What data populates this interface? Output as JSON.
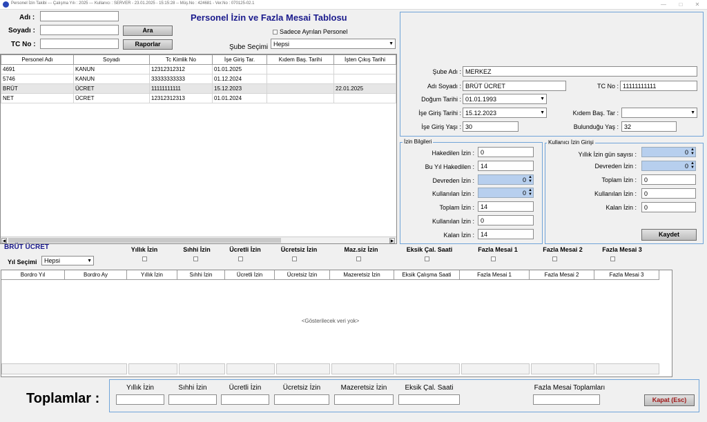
{
  "window": {
    "title": "Personel İzin Takibi  ---  Çalışma Yılı : 2025  ---  Kullanıcı : SERVER - 23.01.2025 - 15:15:28 -- Müş.No : 424681 - Ver.No : 070125-02.1"
  },
  "page_title": "Personel İzin ve Fazla Mesai Tablosu",
  "search": {
    "adi_label": "Adı :",
    "soyadi_label": "Soyadı :",
    "tcno_label": "TC No :",
    "ara_button": "Ara",
    "raporlar_button": "Raporlar",
    "sadece_ayrilan": "Sadece Ayrılan Personel",
    "sube_label": "Şube Seçimi",
    "sube_value": "Hepsi"
  },
  "personel_table": {
    "columns": [
      "Personel Adı",
      "Soyadı",
      "Tc Kimlik No",
      "İşe Giriş Tar.",
      "Kıdem Baş. Tarihi",
      "İşten Çıkış Tarihi"
    ],
    "rows": [
      [
        "4691",
        "KANUN",
        "12312312312",
        "01.01.2025",
        "",
        ""
      ],
      [
        "5746",
        "KANUN",
        "33333333333",
        "01.12.2024",
        "",
        ""
      ],
      [
        "BRÜT",
        "ÜCRET",
        "11111111111",
        "15.12.2023",
        "",
        "22.01.2025"
      ],
      [
        "NET",
        "ÜCRET",
        "12312312313",
        "01.01.2024",
        "",
        ""
      ]
    ]
  },
  "detail": {
    "sube_label": "Şube Adı :",
    "sube_value": "MERKEZ",
    "adsoyad_label": "Adı Soyadı :",
    "adsoyad_value": "BRÜT ÜCRET",
    "tcno_label": "TC No :",
    "tcno_value": "11111111111",
    "dogum_label": "Doğum Tarihi :",
    "dogum_value": "01.01.1993",
    "isegiris_label": "İşe Giriş Tarihi :",
    "isegiris_value": "15.12.2023",
    "kidem_label": "Kıdem Baş. Tar :",
    "kidem_value": "",
    "isegiris_yas_label": "İşe Giriş Yaşı :",
    "isegiris_yas_value": "30",
    "bulundugu_yas_label": "Bulunduğu Yaş :",
    "bulundugu_yas_value": "32"
  },
  "izin_bilgileri": {
    "title": "İzin Bilgileri",
    "fields": [
      {
        "label": "Hakedilen İzin :",
        "value": "0"
      },
      {
        "label": "Bu Yıl Hakedilen :",
        "value": "14"
      },
      {
        "label": "Devreden İzin :",
        "value": "0"
      },
      {
        "label": "Kullanılan İzin :",
        "value": "0"
      },
      {
        "label": "Toplam İzin :",
        "value": "14"
      },
      {
        "label": "Kullanılan İzin :",
        "value": "0"
      },
      {
        "label": "Kalan İzin :",
        "value": "14"
      }
    ]
  },
  "kullanici_izin": {
    "title": "Kullanıcı İzin Girişi",
    "fields": [
      {
        "label": "Yıllık İzin gün sayısı :",
        "value": "0"
      },
      {
        "label": "Devreden İzin :",
        "value": "0"
      },
      {
        "label": "Toplam İzin :",
        "value": "0"
      },
      {
        "label": "Kullanılan İzin :",
        "value": "0"
      },
      {
        "label": "Kalan İzin :",
        "value": "0"
      }
    ],
    "kaydet_button": "Kaydet"
  },
  "section": {
    "person_name": "BRÜT ÜCRET",
    "yil_label": "Yıl Seçimi",
    "yil_value": "Hepsi",
    "filter_labels": [
      "Yıllık İzin",
      "Sıhhi İzin",
      "Ücretli İzin",
      "Ücretsiz İzin",
      "Maz.siz İzin",
      "Eksik Çal. Saati",
      "Fazla Mesai 1",
      "Fazla Mesai 2",
      "Fazla Mesai 3"
    ]
  },
  "bordro_table": {
    "columns": [
      "Bordro Yıl",
      "Bordro Ay",
      "Yıllık İzin",
      "Sıhhi İzin",
      "Ücretli İzin",
      "Ücretsiz İzin",
      "Mazeretsiz İzin",
      "Eksik Çalışma Saati",
      "Fazla Mesai 1",
      "Fazla Mesai 2",
      "Fazla Mesai 3"
    ],
    "empty_text": "<Gösterilecek veri yok>"
  },
  "toplamlar": {
    "label": "Toplamlar :",
    "columns": [
      "Yıllık İzin",
      "Sıhhi İzin",
      "Ücretli İzin",
      "Ücretsiz İzin",
      "Mazeretsiz İzin",
      "Eksik Çal. Saati",
      "Fazla Mesai Toplamları"
    ],
    "kapat_button": "Kapat (Esc)",
    "kapat_color": "#a01818"
  }
}
